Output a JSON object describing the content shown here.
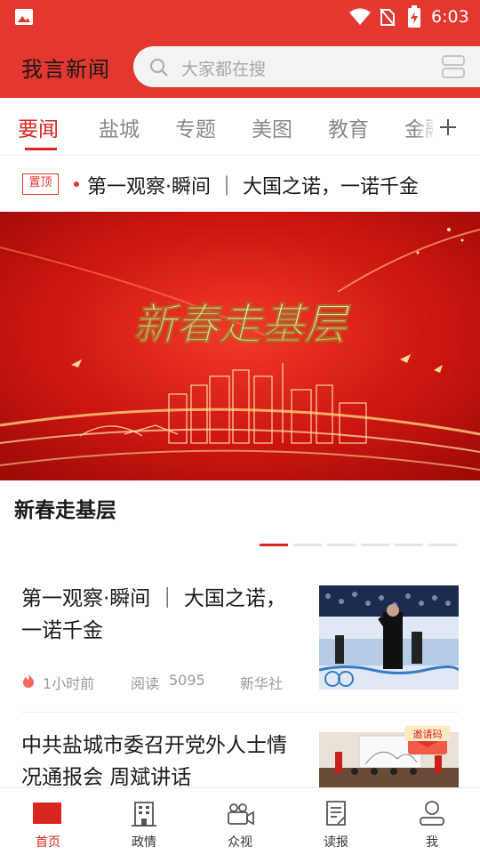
{
  "status_bar": {
    "time": "6:03"
  },
  "header": {
    "app_title": "我言新闻",
    "search_placeholder": "大家都在搜"
  },
  "tabs": [
    "要闻",
    "盐城",
    "专题",
    "美图",
    "教育",
    "金融"
  ],
  "pinned": {
    "badge": "置顶",
    "text": "第一观察·瞬间 ｜ 大国之诺，一诺千金"
  },
  "banner": {
    "headline": "新春走基层",
    "caption": "新春走基层",
    "slide_count": 6,
    "active_slide": 1
  },
  "news": [
    {
      "title": "第一观察·瞬间 ｜ 大国之诺，一诺千金",
      "time": "1小时前",
      "read_label": "阅读",
      "read_count": "5095",
      "source": "新华社"
    },
    {
      "title": "中共盐城市委召开党外人士情况通报会 周斌讲话"
    }
  ],
  "invite_badge": "邀请码",
  "tabbar": [
    {
      "label": "首页",
      "icon": "home-icon"
    },
    {
      "label": "政情",
      "icon": "building-icon"
    },
    {
      "label": "众视",
      "icon": "video-camera-icon"
    },
    {
      "label": "读报",
      "icon": "newspaper-icon"
    },
    {
      "label": "我",
      "icon": "user-icon"
    }
  ],
  "colors": {
    "brand_red": "#e3372f",
    "active_red": "#d8251d"
  }
}
